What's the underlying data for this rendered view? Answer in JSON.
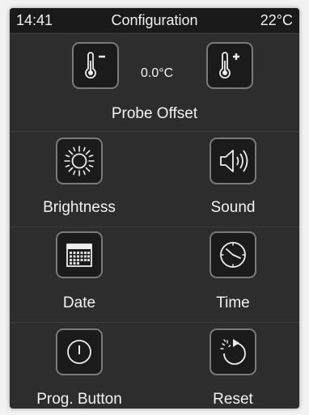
{
  "statusbar": {
    "time": "14:41",
    "title": "Configuration",
    "temperature": "22°C"
  },
  "probe_offset": {
    "label": "Probe Offset",
    "value": "0.0°C",
    "decrease_icon": "thermometer-minus-icon",
    "increase_icon": "thermometer-plus-icon"
  },
  "tiles": {
    "brightness": {
      "label": "Brightness",
      "icon": "sun-icon"
    },
    "sound": {
      "label": "Sound",
      "icon": "speaker-icon"
    },
    "date": {
      "label": "Date",
      "icon": "calendar-icon"
    },
    "time": {
      "label": "Time",
      "icon": "clock-icon"
    },
    "prog_button": {
      "label": "Prog. Button",
      "icon": "power-icon"
    },
    "reset": {
      "label": "Reset",
      "icon": "reset-icon"
    }
  },
  "colors": {
    "background": "#232323",
    "tile_border": "#7a7a7a",
    "text": "#f2f2f2"
  }
}
